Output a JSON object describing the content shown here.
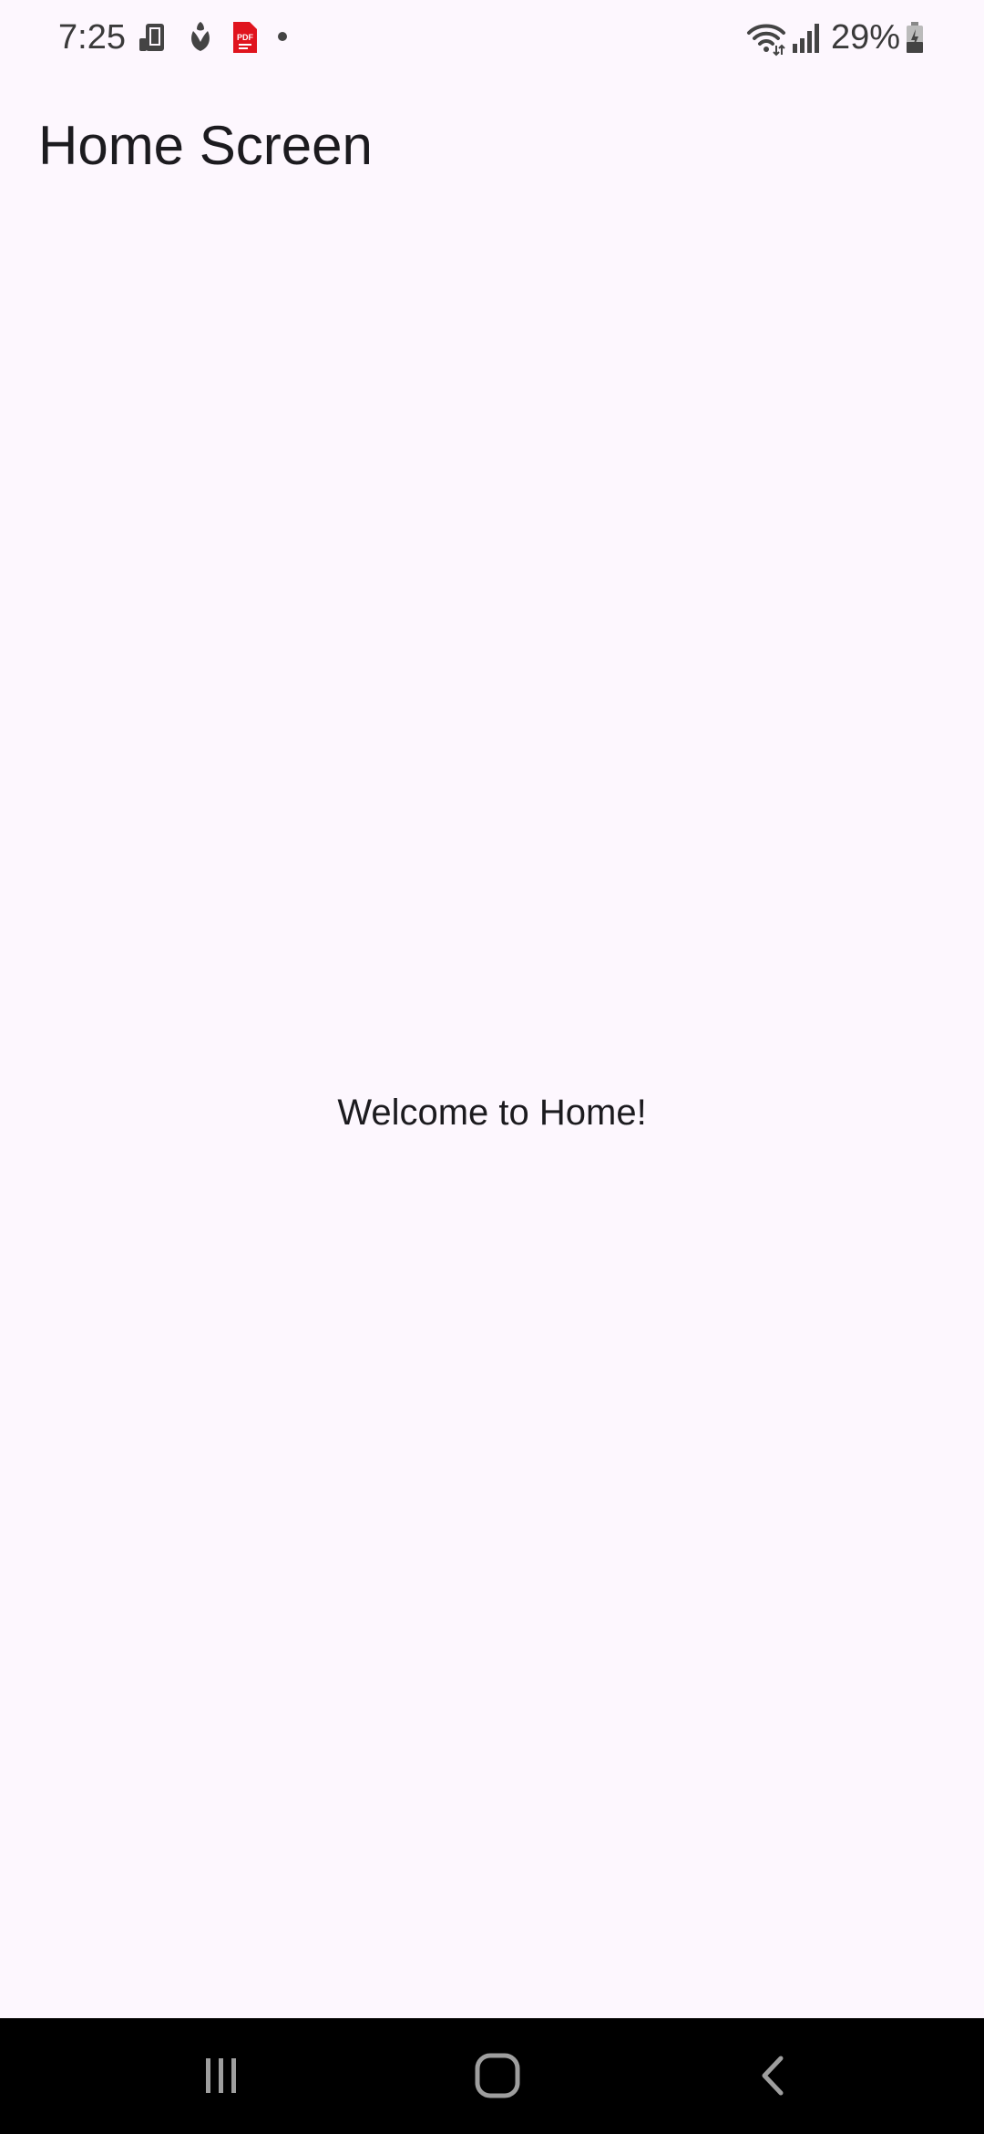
{
  "status_bar": {
    "time": "7:25",
    "battery_percent": "29%",
    "icons_left": [
      "device-icon",
      "flower-icon",
      "pdf-icon",
      "dot-icon"
    ],
    "icons_right": [
      "wifi-icon",
      "signal-icon",
      "battery-icon"
    ],
    "pdf_color": "#e0141e"
  },
  "app_bar": {
    "title": "Home Screen"
  },
  "content": {
    "message": "Welcome to Home!"
  },
  "nav_bar": {
    "buttons": [
      "recents-icon",
      "home-icon",
      "back-icon"
    ]
  },
  "colors": {
    "background": "#fdf7fe",
    "text": "#1c1b1f",
    "nav_background": "#000000"
  }
}
